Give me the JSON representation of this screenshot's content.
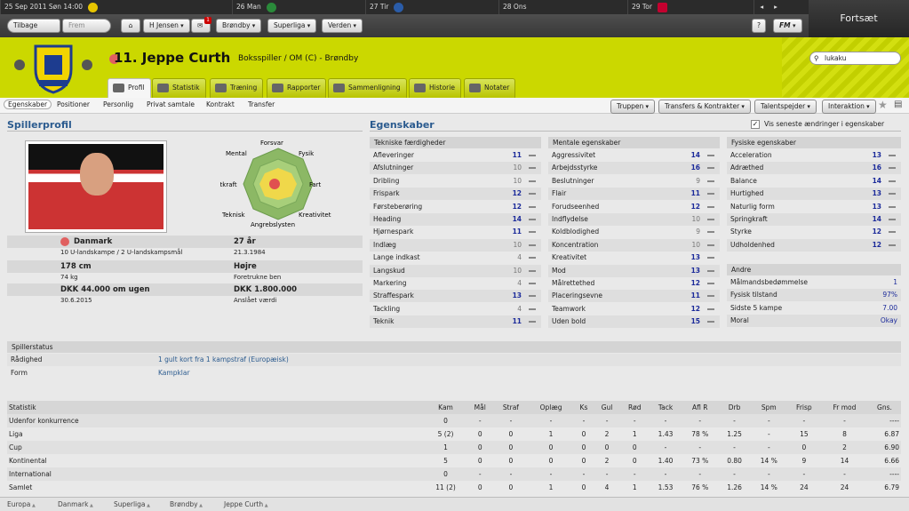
{
  "calendar": [
    {
      "date": "25 Sep 2011 Søn 14:00"
    },
    {
      "date": "26 Man"
    },
    {
      "date": "27 Tir"
    },
    {
      "date": "28 Ons"
    },
    {
      "date": "29 Tor"
    }
  ],
  "continue_label": "Fortsæt",
  "nav": {
    "back": "Tilbage",
    "forward": "Frem",
    "manager": "H Jensen",
    "club": "Brøndby",
    "league": "Superliga",
    "world": "Verden",
    "inbox_count": "1",
    "fm": "FM"
  },
  "search": {
    "value": "lukaku"
  },
  "player": {
    "title": "11. Jeppe Curth",
    "position": "Boksspiller / OM (C) - Brøndby"
  },
  "tabs": [
    "Profil",
    "Statistik",
    "Træning",
    "Rapporter",
    "Sammenligning",
    "Historie",
    "Notater"
  ],
  "subtabs": [
    "Egenskaber",
    "Positioner",
    "Personlig",
    "Privat samtale",
    "Kontrakt",
    "Transfer"
  ],
  "actions": [
    "Truppen",
    "Transfers & Kontrakter",
    "Talentspejder",
    "Interaktion"
  ],
  "profile": {
    "heading": "Spillerprofil",
    "nation": "Danmark",
    "caps": "10 U-landskampe / 2 U-landskampsmål",
    "age": "27 år",
    "dob": "21.3.1984",
    "height": "178 cm",
    "weight": "74 kg",
    "foot": "Højre",
    "foot_sub": "Foretrukne ben",
    "wage": "DKK 44.000 om ugen",
    "contract": "30.6.2015",
    "value": "DKK 1.800.000",
    "value_sub": "Anslået værdi"
  },
  "radar": {
    "labels": [
      "Forsvar",
      "Fysik",
      "Fart",
      "Kreativitet",
      "Angrebslysten",
      "Teknisk",
      "Luftkraft",
      "Mental"
    ]
  },
  "attributes": {
    "heading": "Egenskaber",
    "show_changes": "Vis seneste ændringer i egenskaber",
    "technical": {
      "title": "Tekniske færdigheder",
      "rows": [
        [
          "Afleveringer",
          "11"
        ],
        [
          "Afslutninger",
          "10"
        ],
        [
          "Dribling",
          "10"
        ],
        [
          "Frispark",
          "12"
        ],
        [
          "Førsteberøring",
          "12"
        ],
        [
          "Heading",
          "14"
        ],
        [
          "Hjørnespark",
          "11"
        ],
        [
          "Indlæg",
          "10"
        ],
        [
          "Lange indkast",
          "4"
        ],
        [
          "Langskud",
          "10"
        ],
        [
          "Markering",
          "4"
        ],
        [
          "Straffespark",
          "13"
        ],
        [
          "Tackling",
          "4"
        ],
        [
          "Teknik",
          "11"
        ]
      ]
    },
    "mental": {
      "title": "Mentale egenskaber",
      "rows": [
        [
          "Aggressivitet",
          "14"
        ],
        [
          "Arbejdsstyrke",
          "16"
        ],
        [
          "Beslutninger",
          "9"
        ],
        [
          "Flair",
          "11"
        ],
        [
          "Forudseenhed",
          "12"
        ],
        [
          "Indflydelse",
          "10"
        ],
        [
          "Koldblodighed",
          "9"
        ],
        [
          "Koncentration",
          "10"
        ],
        [
          "Kreativitet",
          "13"
        ],
        [
          "Mod",
          "13"
        ],
        [
          "Målrettethed",
          "12"
        ],
        [
          "Placeringsevne",
          "11"
        ],
        [
          "Teamwork",
          "12"
        ],
        [
          "Uden bold",
          "15"
        ]
      ]
    },
    "physical": {
      "title": "Fysiske egenskaber",
      "rows": [
        [
          "Acceleration",
          "13"
        ],
        [
          "Adræthed",
          "16"
        ],
        [
          "Balance",
          "14"
        ],
        [
          "Hurtighed",
          "13"
        ],
        [
          "Naturlig form",
          "13"
        ],
        [
          "Springkraft",
          "14"
        ],
        [
          "Styrke",
          "12"
        ],
        [
          "Udholdenhed",
          "12"
        ]
      ]
    },
    "other": {
      "title": "Andre",
      "rows": [
        [
          "Målmandsbedømmelse",
          "1"
        ],
        [
          "Fysisk tilstand",
          "97%"
        ],
        [
          "Sidste 5 kampe",
          "7.00"
        ],
        [
          "Moral",
          "Okay"
        ]
      ]
    }
  },
  "status": {
    "title": "Spillerstatus",
    "rows": [
      [
        "Rådighed",
        "1 gult kort fra 1 kampstraf (Europæisk)"
      ],
      [
        "Form",
        "Kampklar"
      ]
    ]
  },
  "stats": {
    "headers": [
      "Statistik",
      "Kam",
      "Mål",
      "Straf",
      "Oplæg",
      "Ks",
      "Gul",
      "Rød",
      "Tack",
      "Afl R",
      "Drb",
      "Spm",
      "Frisp",
      "Fr mod",
      "Gns."
    ],
    "rows": [
      [
        "Udenfor konkurrence",
        "0",
        "-",
        "-",
        "-",
        "-",
        "-",
        "-",
        "-",
        "-",
        "-",
        "-",
        "-",
        "-",
        "----"
      ],
      [
        "Liga",
        "5 (2)",
        "0",
        "0",
        "1",
        "0",
        "2",
        "1",
        "1.43",
        "78 %",
        "1.25",
        "-",
        "15",
        "8",
        "6.87"
      ],
      [
        "Cup",
        "1",
        "0",
        "0",
        "0",
        "0",
        "0",
        "0",
        "-",
        "-",
        "-",
        "-",
        "0",
        "2",
        "6.90"
      ],
      [
        "Kontinental",
        "5",
        "0",
        "0",
        "0",
        "0",
        "2",
        "0",
        "1.40",
        "73 %",
        "0.80",
        "14 %",
        "9",
        "14",
        "6.66"
      ],
      [
        "International",
        "0",
        "-",
        "-",
        "-",
        "-",
        "-",
        "-",
        "-",
        "-",
        "-",
        "-",
        "-",
        "-",
        "----"
      ],
      [
        "Samlet",
        "11 (2)",
        "0",
        "0",
        "1",
        "0",
        "4",
        "1",
        "1.53",
        "76 %",
        "1.26",
        "14 %",
        "24",
        "24",
        "6.79"
      ]
    ]
  },
  "breadcrumb": [
    "Europa",
    "Danmark",
    "Superliga",
    "Brøndby",
    "Jeppe Curth"
  ]
}
